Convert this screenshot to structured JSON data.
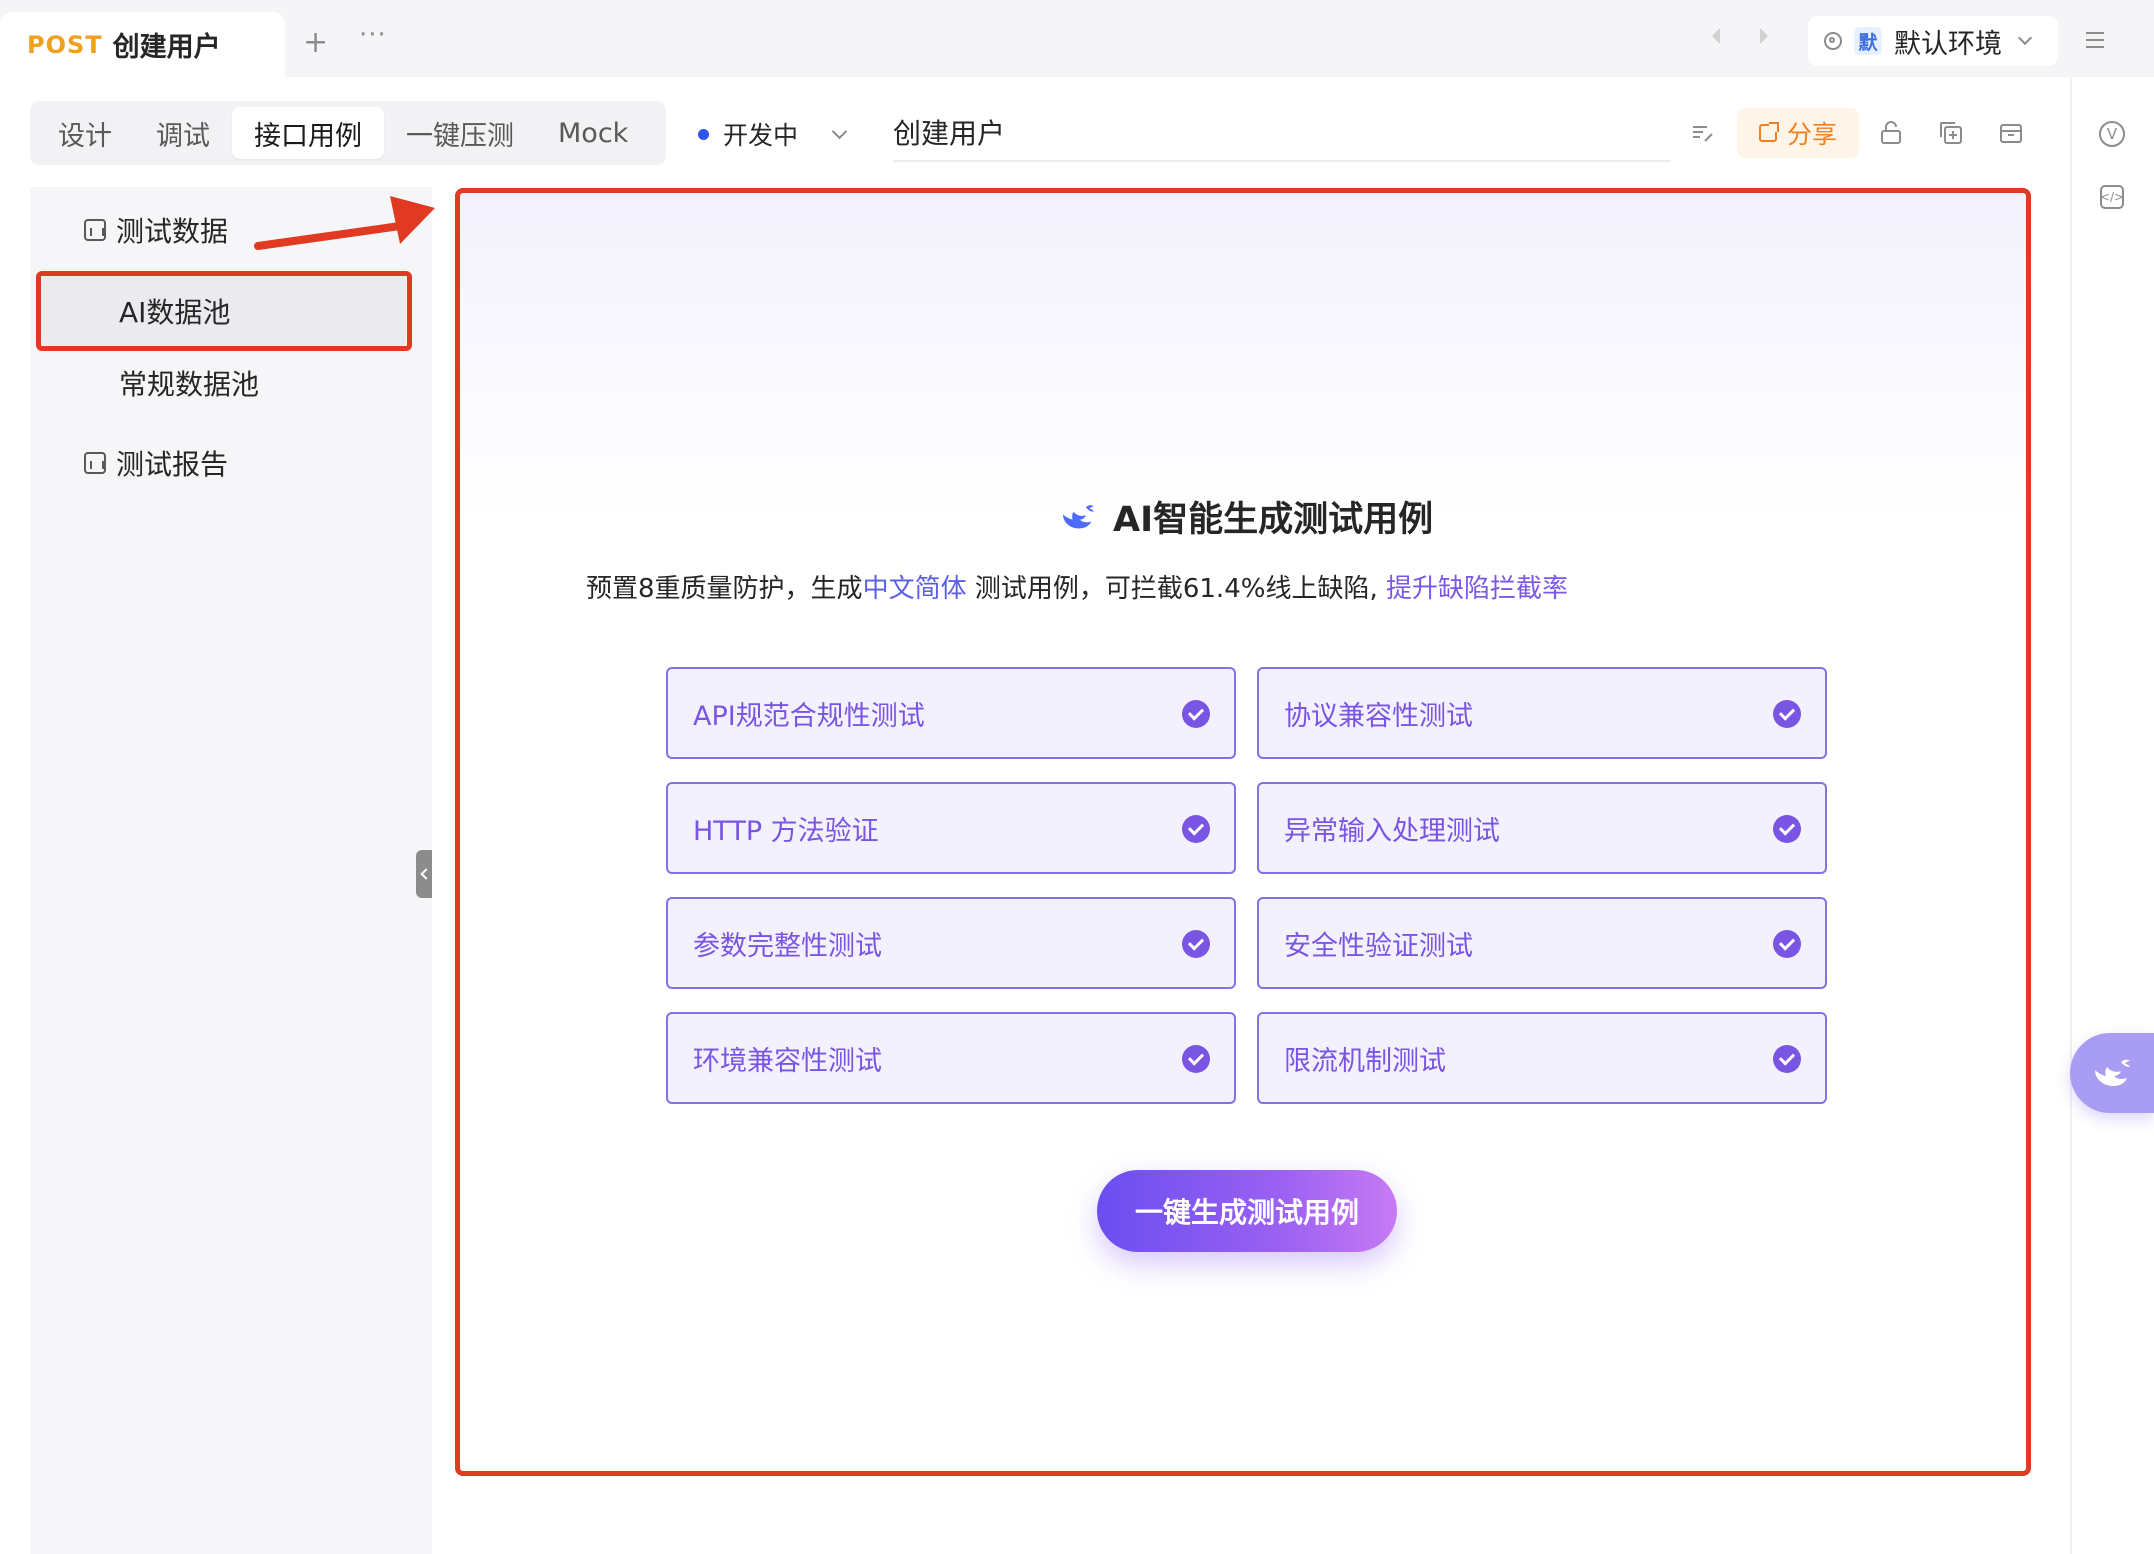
{
  "top_tab": {
    "method": "POST",
    "title": "创建用户"
  },
  "environment": {
    "badge": "默",
    "name": "默认环境"
  },
  "sub_tabs": [
    {
      "label": "设计"
    },
    {
      "label": "调试"
    },
    {
      "label": "接口用例",
      "active": true
    },
    {
      "label": "一键压测"
    },
    {
      "label": "Mock"
    }
  ],
  "status": {
    "label": "开发中",
    "color": "#2f54eb"
  },
  "endpoint_name": "创建用户",
  "share_label": "分享",
  "rail": {
    "v_label": "V",
    "code_label": "</>"
  },
  "sidebar": {
    "test_data": "测试数据",
    "ai_pool": "AI数据池",
    "regular_pool": "常规数据池",
    "test_report": "测试报告"
  },
  "hero": {
    "title": "AI智能生成测试用例",
    "subtitle_pre": "预置8重质量防护，生成",
    "subtitle_lang": "中文简体",
    "subtitle_mid": " 测试用例，可拦截61.4%线上缺陷, ",
    "subtitle_link": "提升缺陷拦截率"
  },
  "test_types": [
    {
      "label": "API规范合规性测试",
      "checked": true
    },
    {
      "label": "协议兼容性测试",
      "checked": true
    },
    {
      "label": "HTTP 方法验证",
      "checked": true
    },
    {
      "label": "异常输入处理测试",
      "checked": true
    },
    {
      "label": "参数完整性测试",
      "checked": true
    },
    {
      "label": "安全性验证测试",
      "checked": true
    },
    {
      "label": "环境兼容性测试",
      "checked": true
    },
    {
      "label": "限流机制测试",
      "checked": true
    }
  ],
  "generate_button": "一键生成测试用例",
  "colors": {
    "accent": "#7a55e3",
    "highlight": "#e03a22",
    "method": "#f0a020",
    "share": "#f08020"
  }
}
